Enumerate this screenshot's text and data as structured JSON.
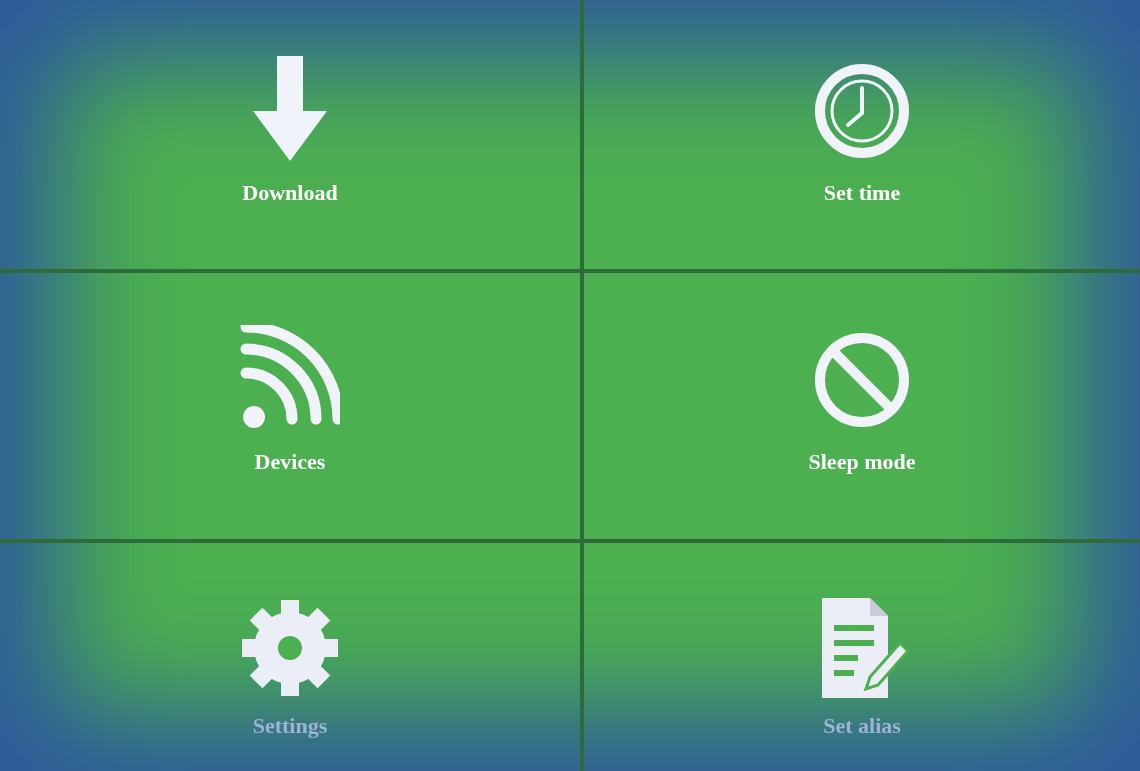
{
  "tiles": [
    {
      "kind": "download",
      "label": "Download"
    },
    {
      "kind": "clock",
      "label": "Set time"
    },
    {
      "kind": "signal",
      "label": "Devices"
    },
    {
      "kind": "block",
      "label": "Sleep mode"
    },
    {
      "kind": "gear",
      "label": "Settings"
    },
    {
      "kind": "note",
      "label": "Set alias"
    }
  ]
}
